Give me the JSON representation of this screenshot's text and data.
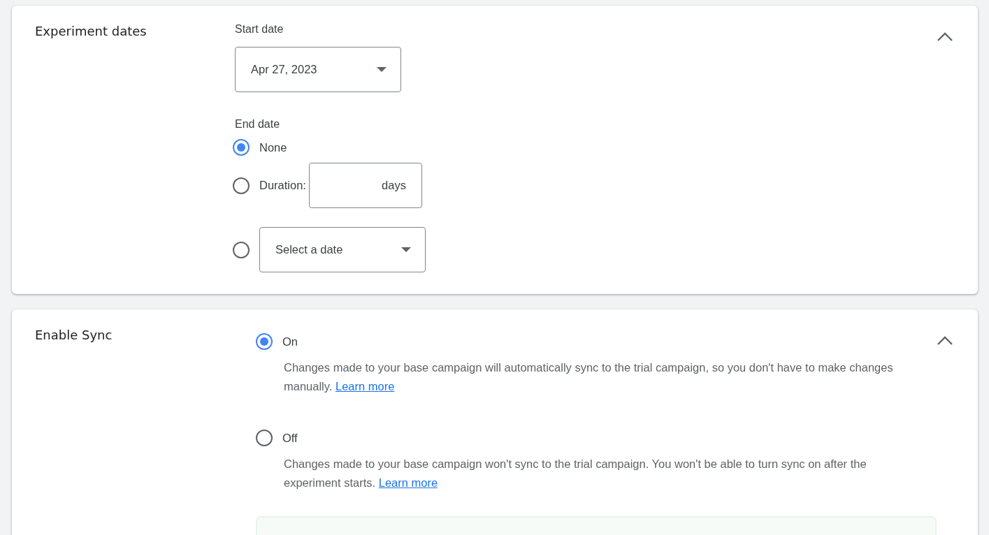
{
  "sections": [
    {
      "kind": "dates",
      "title": "Experiment dates",
      "expanded": true,
      "start_date": {
        "label": "Start date",
        "value": "Apr 27, 2023"
      },
      "end_date": {
        "label": "End date",
        "options": [
          {
            "kind": "plain",
            "label": "None",
            "selected": true
          },
          {
            "kind": "duration",
            "label": "Duration:",
            "unit": "days",
            "selected": false
          },
          {
            "kind": "date",
            "placeholder": "Select a date",
            "selected": false
          }
        ]
      }
    },
    {
      "kind": "sync",
      "title": "Enable Sync",
      "expanded": true,
      "options": [
        {
          "label": "On",
          "selected": true,
          "description": "Changes made to your base campaign will automatically sync to the trial campaign, so you don't have to make changes manually.",
          "link": "Learn more"
        },
        {
          "label": "Off",
          "selected": false,
          "description": "Changes made to your base campaign won't sync to the trial campaign. You won't be able to turn sync on after the experiment starts.",
          "link": "Learn more"
        }
      ]
    }
  ]
}
